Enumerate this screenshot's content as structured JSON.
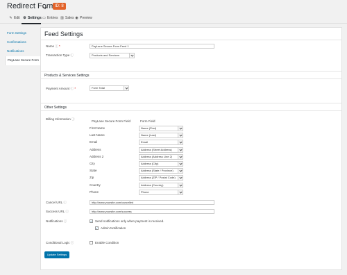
{
  "header": {
    "form_title": "Redirect Form",
    "form_id": "ID: 8"
  },
  "toolbar": {
    "edit": "Edit",
    "settings": "Settings",
    "entries": "Entries",
    "sales": "Sales",
    "preview": "Preview"
  },
  "sidebar": {
    "items": [
      {
        "label": "Form Settings"
      },
      {
        "label": "Confirmations"
      },
      {
        "label": "Notifications"
      },
      {
        "label": "PayLane Secure Form"
      }
    ]
  },
  "feed": {
    "title": "Feed Settings",
    "name_label": "Name",
    "name_value": "PayLane Secure Form Feed 1",
    "transaction_type_label": "Transaction Type",
    "transaction_type_value": "Products and Services",
    "products_section": "Products & Services Settings",
    "payment_amount_label": "Payment Amount",
    "payment_amount_value": "Form Total",
    "other_section": "Other Settings",
    "billing_label": "Billing Information",
    "billing_col1": "PayLane Secure Form Field",
    "billing_col2": "Form Field",
    "billing_rows": [
      {
        "field": "First Name",
        "value": "Name (First)"
      },
      {
        "field": "Last Name",
        "value": "Name (Last)"
      },
      {
        "field": "Email",
        "value": "Email"
      },
      {
        "field": "Address",
        "value": "Address (Street Address)"
      },
      {
        "field": "Address 2",
        "value": "Address (Address Line 2)"
      },
      {
        "field": "City",
        "value": "Address (City)"
      },
      {
        "field": "State",
        "value": "Address (State / Province)"
      },
      {
        "field": "Zip",
        "value": "Address (ZIP / Postal Code)"
      },
      {
        "field": "Country",
        "value": "Address (Country)"
      },
      {
        "field": "Phone",
        "value": "Phone"
      }
    ],
    "cancel_url_label": "Cancel URL",
    "cancel_url_value": "http://www.yoursite.com/cancelled",
    "success_url_label": "Success URL",
    "success_url_value": "http://www.yoursite.com/success",
    "notifications_label": "Notifications",
    "notifications_option": "Send notifications only when payment is received.",
    "admin_notification": "Admin Notification",
    "conditional_logic_label": "Conditional Logic",
    "enable_condition": "Enable Condition",
    "update_button": "Update Settings"
  },
  "colors": {
    "accent": "#0073aa",
    "badge": "#e2632a"
  }
}
